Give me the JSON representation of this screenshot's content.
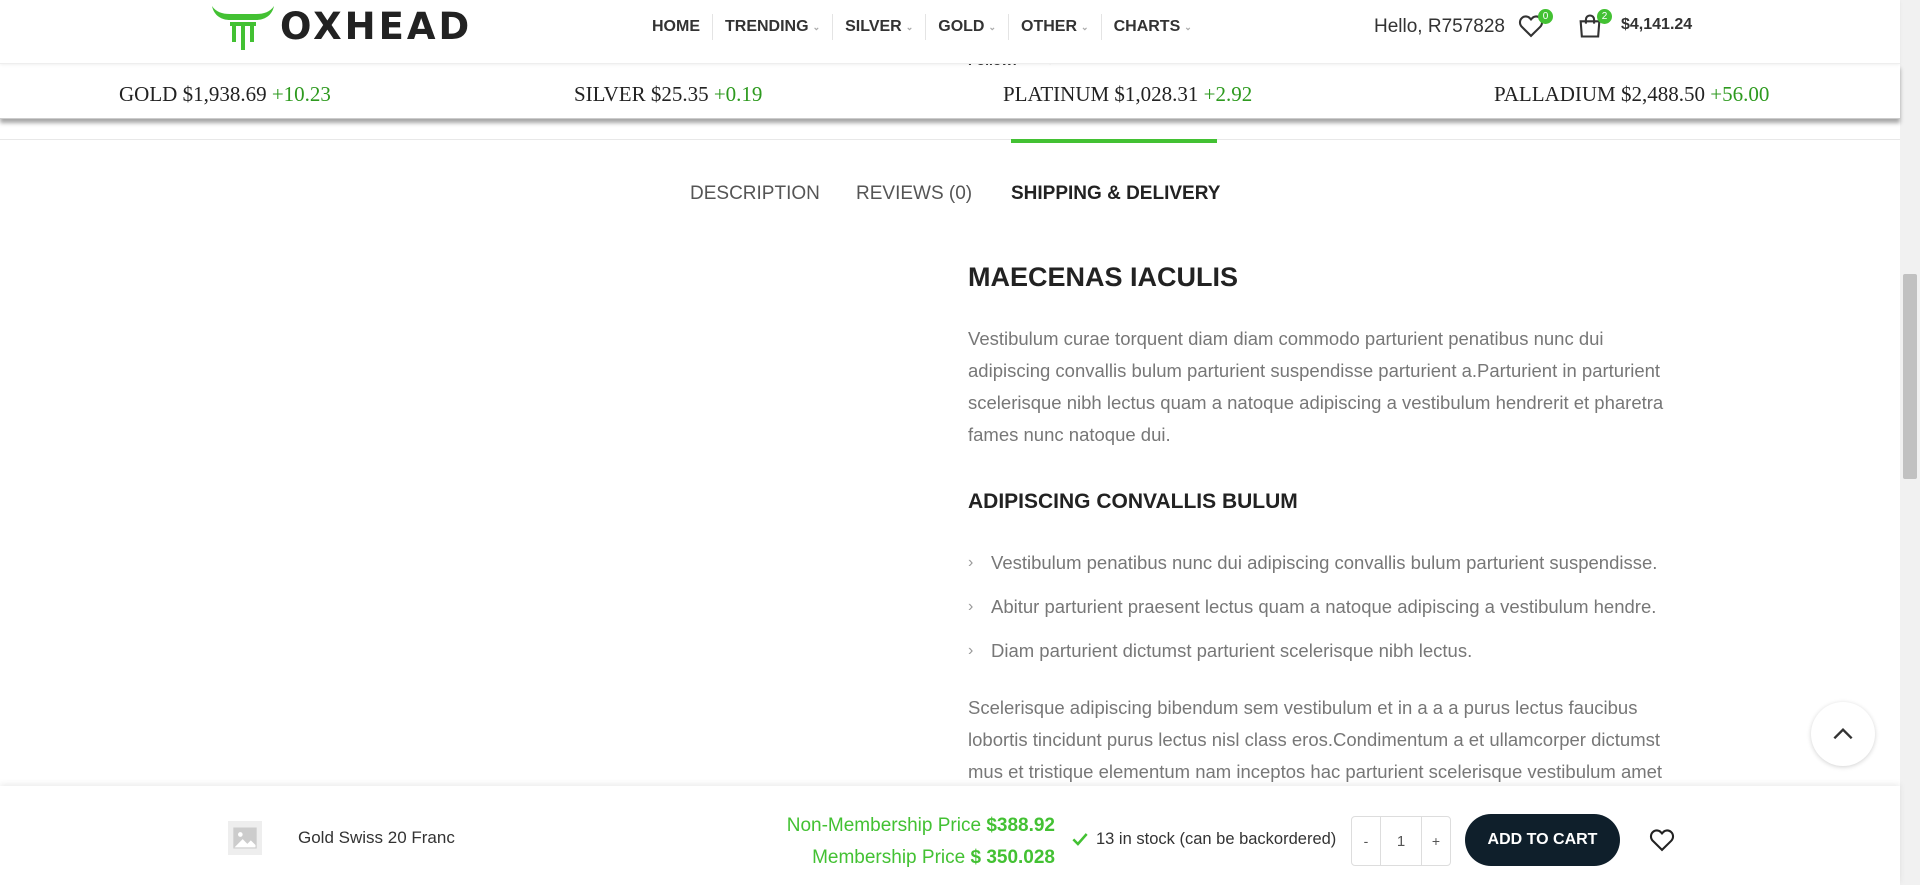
{
  "header": {
    "logo_text": "OXHEAD",
    "nav": [
      {
        "label": "HOME",
        "has_dropdown": false
      },
      {
        "label": "TRENDING",
        "has_dropdown": true
      },
      {
        "label": "SILVER",
        "has_dropdown": true
      },
      {
        "label": "GOLD",
        "has_dropdown": true
      },
      {
        "label": "OTHER",
        "has_dropdown": true
      },
      {
        "label": "CHARTS",
        "has_dropdown": true
      }
    ],
    "greeting": "Hello, R757828",
    "wishlist_count": "0",
    "cart_count": "2",
    "cart_total": "$4,141.24"
  },
  "follow": {
    "label": "Follow:",
    "icons": [
      "facebook-icon",
      "twitter-icon",
      "instagram-icon"
    ]
  },
  "ticker": [
    {
      "metal": "GOLD",
      "price": "$1,938.69",
      "change": "+10.23"
    },
    {
      "metal": "SILVER",
      "price": "$25.35",
      "change": "+0.19"
    },
    {
      "metal": "PLATINUM",
      "price": "$1,028.31",
      "change": "+2.92"
    },
    {
      "metal": "PALLADIUM",
      "price": "$2,488.50",
      "change": "+56.00"
    }
  ],
  "tabs": [
    {
      "label": "DESCRIPTION",
      "active": false
    },
    {
      "label": "REVIEWS (0)",
      "active": false
    },
    {
      "label": "SHIPPING & DELIVERY",
      "active": true
    }
  ],
  "content": {
    "heading": "MAECENAS IACULIS",
    "paragraph1": "Vestibulum curae torquent diam diam commodo parturient penatibus nunc dui adipiscing convallis bulum parturient suspendisse parturient a.Parturient in parturient scelerisque nibh lectus quam a natoque adipiscing a vestibulum hendrerit et pharetra fames nunc natoque dui.",
    "subheading": "ADIPISCING CONVALLIS BULUM",
    "bullets": [
      "Vestibulum penatibus nunc dui adipiscing convallis bulum parturient suspendisse.",
      "Abitur parturient praesent lectus quam a natoque adipiscing a vestibulum hendre.",
      "Diam parturient dictumst parturient scelerisque nibh lectus."
    ],
    "paragraph2": "Scelerisque adipiscing bibendum sem vestibulum et in a a a purus lectus faucibus lobortis tincidunt purus lectus nisl class eros.Condimentum a et ullamcorper dictumst mus et tristique elementum nam inceptos hac parturient scelerisque vestibulum amet"
  },
  "sticky_bar": {
    "product_name": "Gold Swiss 20 Franc",
    "non_member_label": "Non-Membership Price",
    "non_member_price": "$388.92",
    "member_label": "Membership Price",
    "member_price": "$ 350.028",
    "stock": "13 in stock (can be backordered)",
    "qty_minus": "-",
    "qty_plus": "+",
    "qty_value": "1",
    "add_to_cart": "ADD TO CART"
  },
  "colors": {
    "accent": "#43c133",
    "ticker_change": "#2e9a1f",
    "button_dark": "#0f1f2b"
  }
}
